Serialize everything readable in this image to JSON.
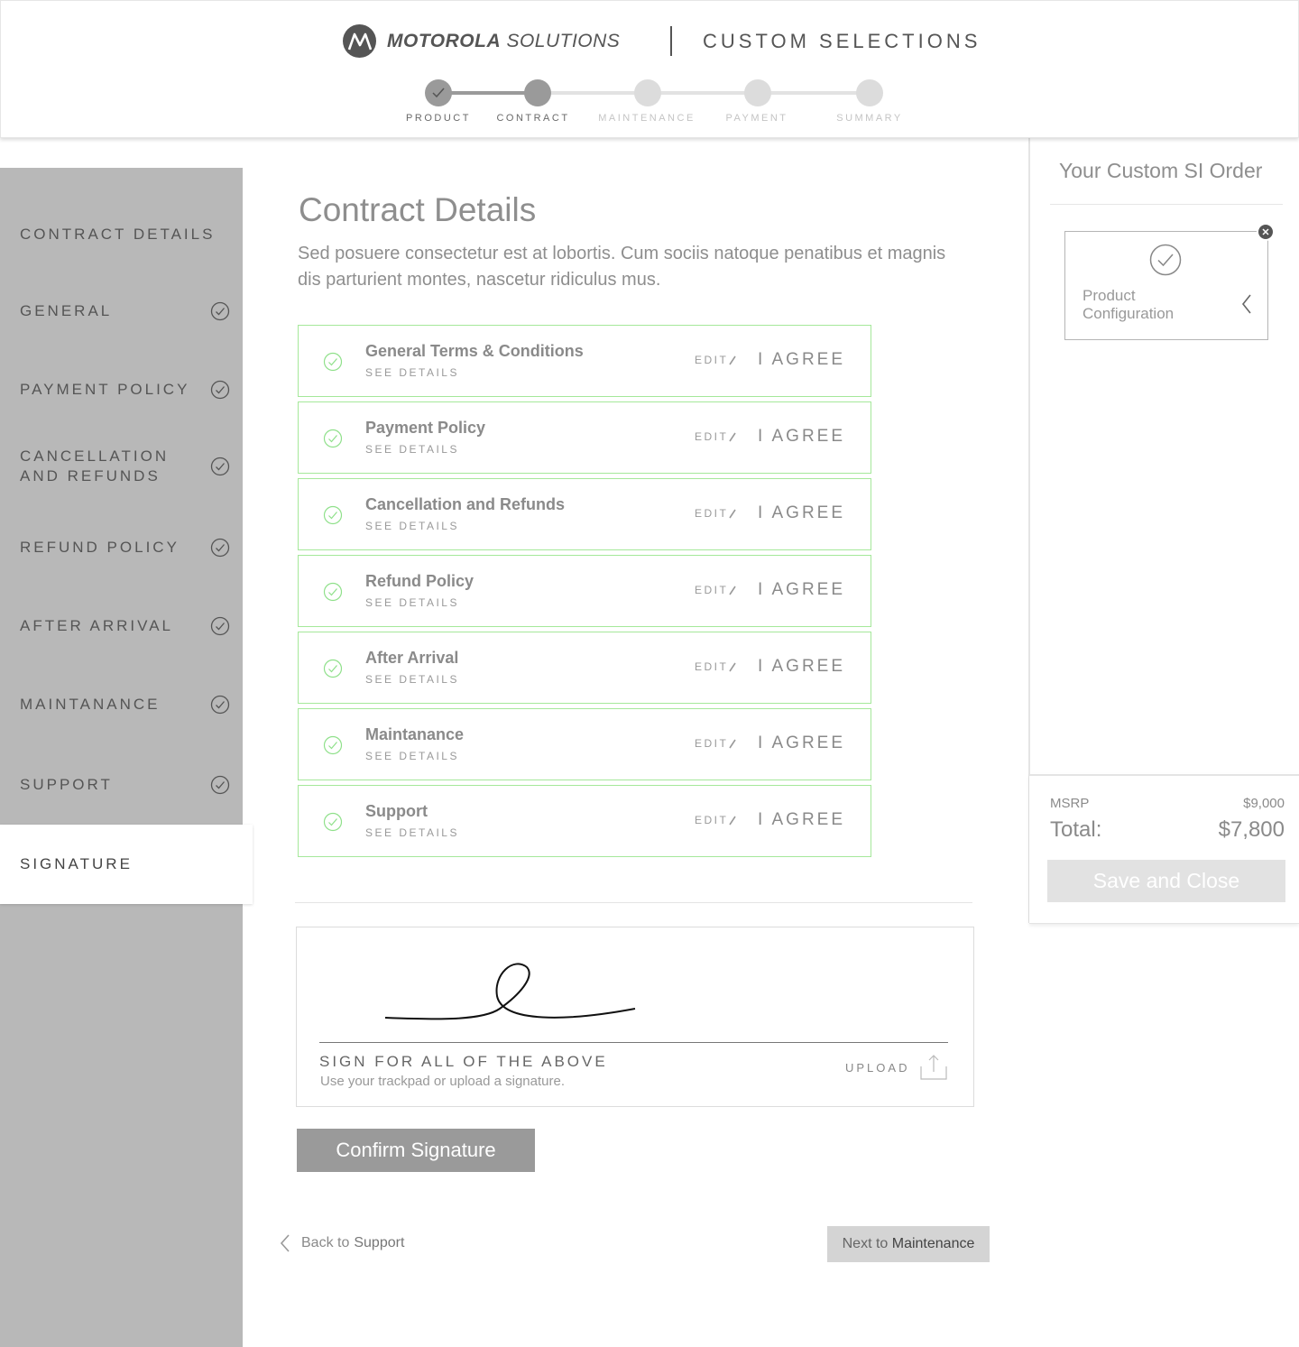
{
  "header": {
    "brand_bold": "MOTOROLA",
    "brand_light": "SOLUTIONS",
    "section_title": "CUSTOM SELECTIONS"
  },
  "steps": [
    {
      "label": "PRODUCT",
      "state": "done"
    },
    {
      "label": "CONTRACT",
      "state": "current"
    },
    {
      "label": "MAINTENANCE",
      "state": "todo"
    },
    {
      "label": "PAYMENT",
      "state": "todo"
    },
    {
      "label": "SUMMARY",
      "state": "todo"
    }
  ],
  "sidebar": {
    "items": [
      {
        "label": "CONTRACT DETAILS",
        "checked": false
      },
      {
        "label": "GENERAL",
        "checked": true
      },
      {
        "label": "PAYMENT POLICY",
        "checked": true
      },
      {
        "label": "CANCELLATION\nAND REFUNDS",
        "checked": true
      },
      {
        "label": "REFUND POLICY",
        "checked": true
      },
      {
        "label": "AFTER ARRIVAL",
        "checked": true
      },
      {
        "label": "MAINTANANCE",
        "checked": true
      },
      {
        "label": "SUPPORT",
        "checked": true
      },
      {
        "label": "SIGNATURE",
        "checked": false,
        "active": true
      }
    ]
  },
  "main": {
    "title": "Contract Details",
    "description": "Sed posuere consectetur est at lobortis. Cum sociis natoque penatibus et magnis dis parturient montes, nascetur ridiculus mus.",
    "terms": [
      {
        "title": "General Terms & Conditions",
        "details": "SEE DETAILS",
        "edit": "EDIT",
        "agree": "I AGREE"
      },
      {
        "title": "Payment Policy",
        "details": "SEE DETAILS",
        "edit": "EDIT",
        "agree": "I AGREE"
      },
      {
        "title": "Cancellation and Refunds",
        "details": "SEE DETAILS",
        "edit": "EDIT",
        "agree": "I AGREE"
      },
      {
        "title": "Refund Policy",
        "details": "SEE DETAILS",
        "edit": "EDIT",
        "agree": "I AGREE"
      },
      {
        "title": "After Arrival",
        "details": "SEE DETAILS",
        "edit": "EDIT",
        "agree": "I AGREE"
      },
      {
        "title": "Maintanance",
        "details": "SEE DETAILS",
        "edit": "EDIT",
        "agree": "I AGREE"
      },
      {
        "title": "Support",
        "details": "SEE DETAILS",
        "edit": "EDIT",
        "agree": "I AGREE"
      }
    ],
    "signature": {
      "title": "SIGN FOR ALL OF THE ABOVE",
      "subtitle": "Use your trackpad or upload a signature.",
      "upload_label": "UPLOAD"
    },
    "confirm_label": "Confirm Signature",
    "back_prefix": "Back to",
    "back_target": "Support",
    "next_prefix": "Next to",
    "next_target": "Maintenance"
  },
  "order": {
    "title": "Your Custom SI Order",
    "card_label": "Product\nConfiguration",
    "msrp_label": "MSRP",
    "msrp_value": "$9,000",
    "total_label": "Total:",
    "total_value": "$7,800",
    "save_label": "Save and Close"
  },
  "colors": {
    "term_border": "#a5e89a",
    "check_green": "#8fe08a",
    "sidebar_bg": "#b8b8b8",
    "button_gray": "#9a9a9a"
  }
}
